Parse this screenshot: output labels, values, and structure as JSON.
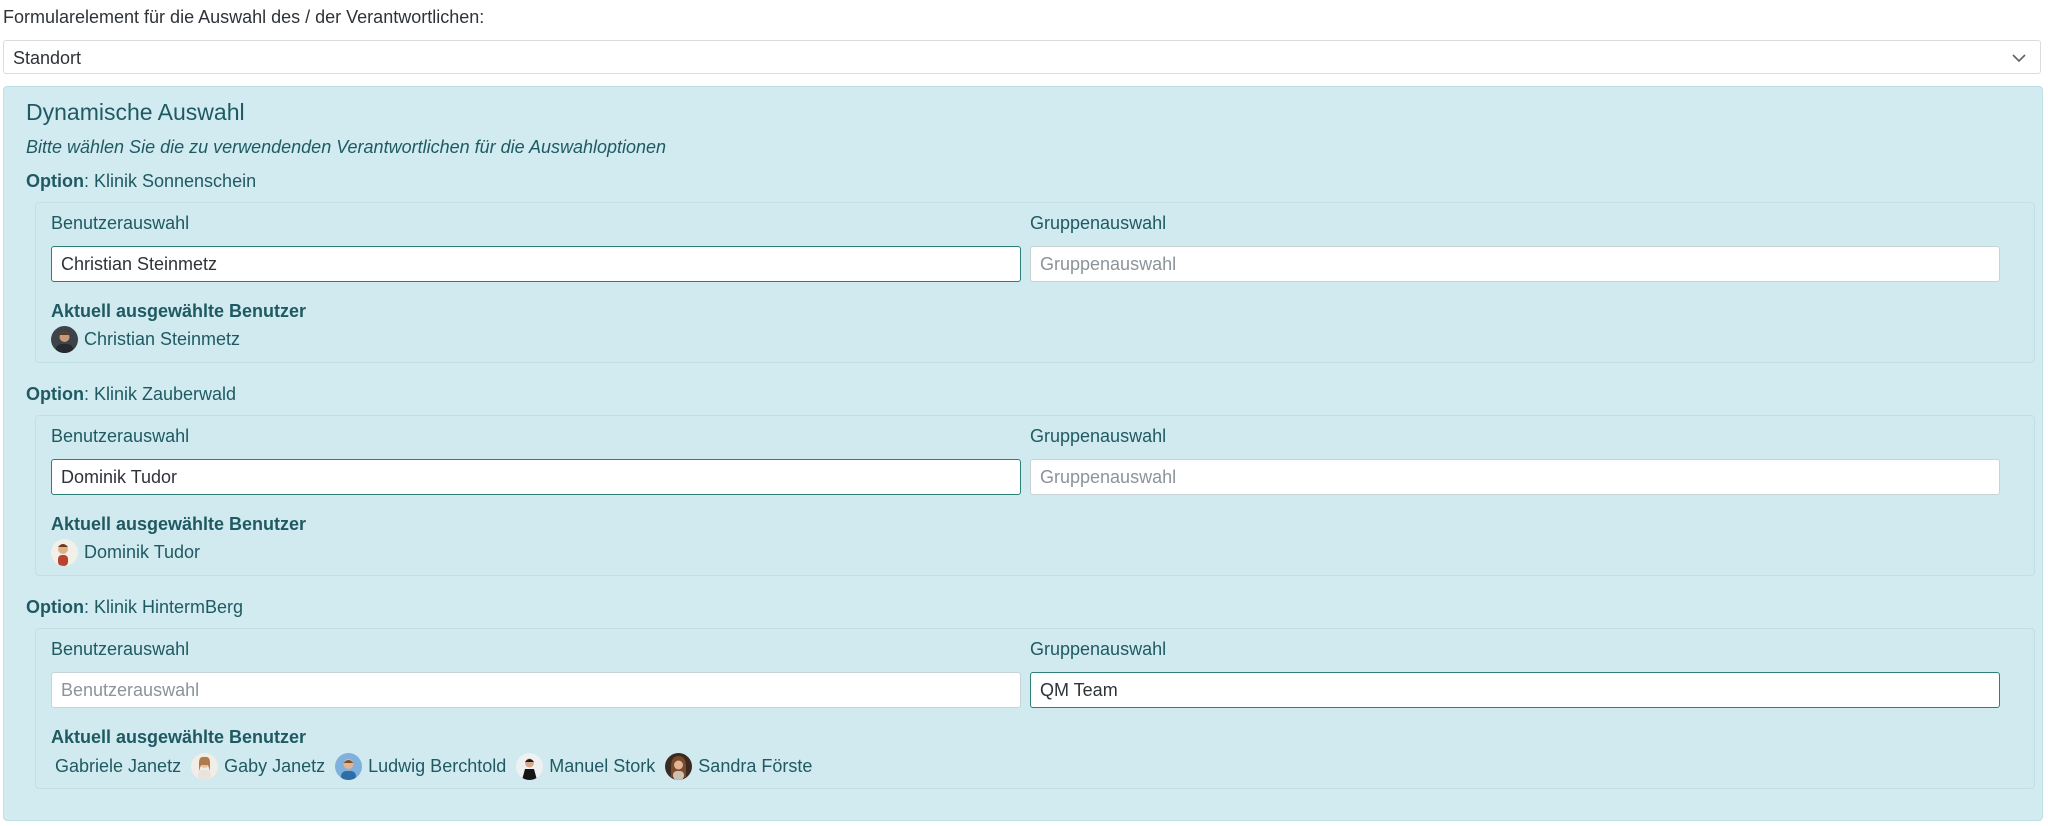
{
  "top_label": "Formularelement für die Auswahl des / der Verantwortlichen:",
  "select": {
    "value": "Standort"
  },
  "panel": {
    "title": "Dynamische Auswahl",
    "subtitle": "Bitte wählen Sie die zu verwendenden Verantwortlichen für die Auswahloptionen"
  },
  "labels": {
    "option_prefix": "Option",
    "user_select": "Benutzerauswahl",
    "group_select": "Gruppenauswahl",
    "user_placeholder": "Benutzerauswahl",
    "group_placeholder": "Gruppenauswahl",
    "selected_users": "Aktuell ausgewählte Benutzer"
  },
  "options": [
    {
      "name": ": Klinik Sonnenschein",
      "user_value": "Christian Steinmetz",
      "group_value": "",
      "selected": [
        {
          "name": "Christian Steinmetz",
          "avatar": "avatar-dark-man"
        }
      ]
    },
    {
      "name": ": Klinik Zauberwald",
      "user_value": "Dominik Tudor",
      "group_value": "",
      "selected": [
        {
          "name": "Dominik Tudor",
          "avatar": "avatar-cartoon-man"
        }
      ]
    },
    {
      "name": ": Klinik HintermBerg",
      "user_value": "",
      "group_value": "QM Team",
      "selected": [
        {
          "name": "Gabriele Janetz",
          "avatar": "none"
        },
        {
          "name": "Gaby Janetz",
          "avatar": "avatar-woman-light"
        },
        {
          "name": "Ludwig Berchtold",
          "avatar": "avatar-man-blue"
        },
        {
          "name": "Manuel Stork",
          "avatar": "avatar-man-black"
        },
        {
          "name": "Sandra Förste",
          "avatar": "avatar-woman-brown"
        }
      ]
    }
  ],
  "colors": {
    "panel_bg": "#d2ebf0",
    "text_teal": "#1f5a63",
    "active_border": "#2e7f77"
  }
}
